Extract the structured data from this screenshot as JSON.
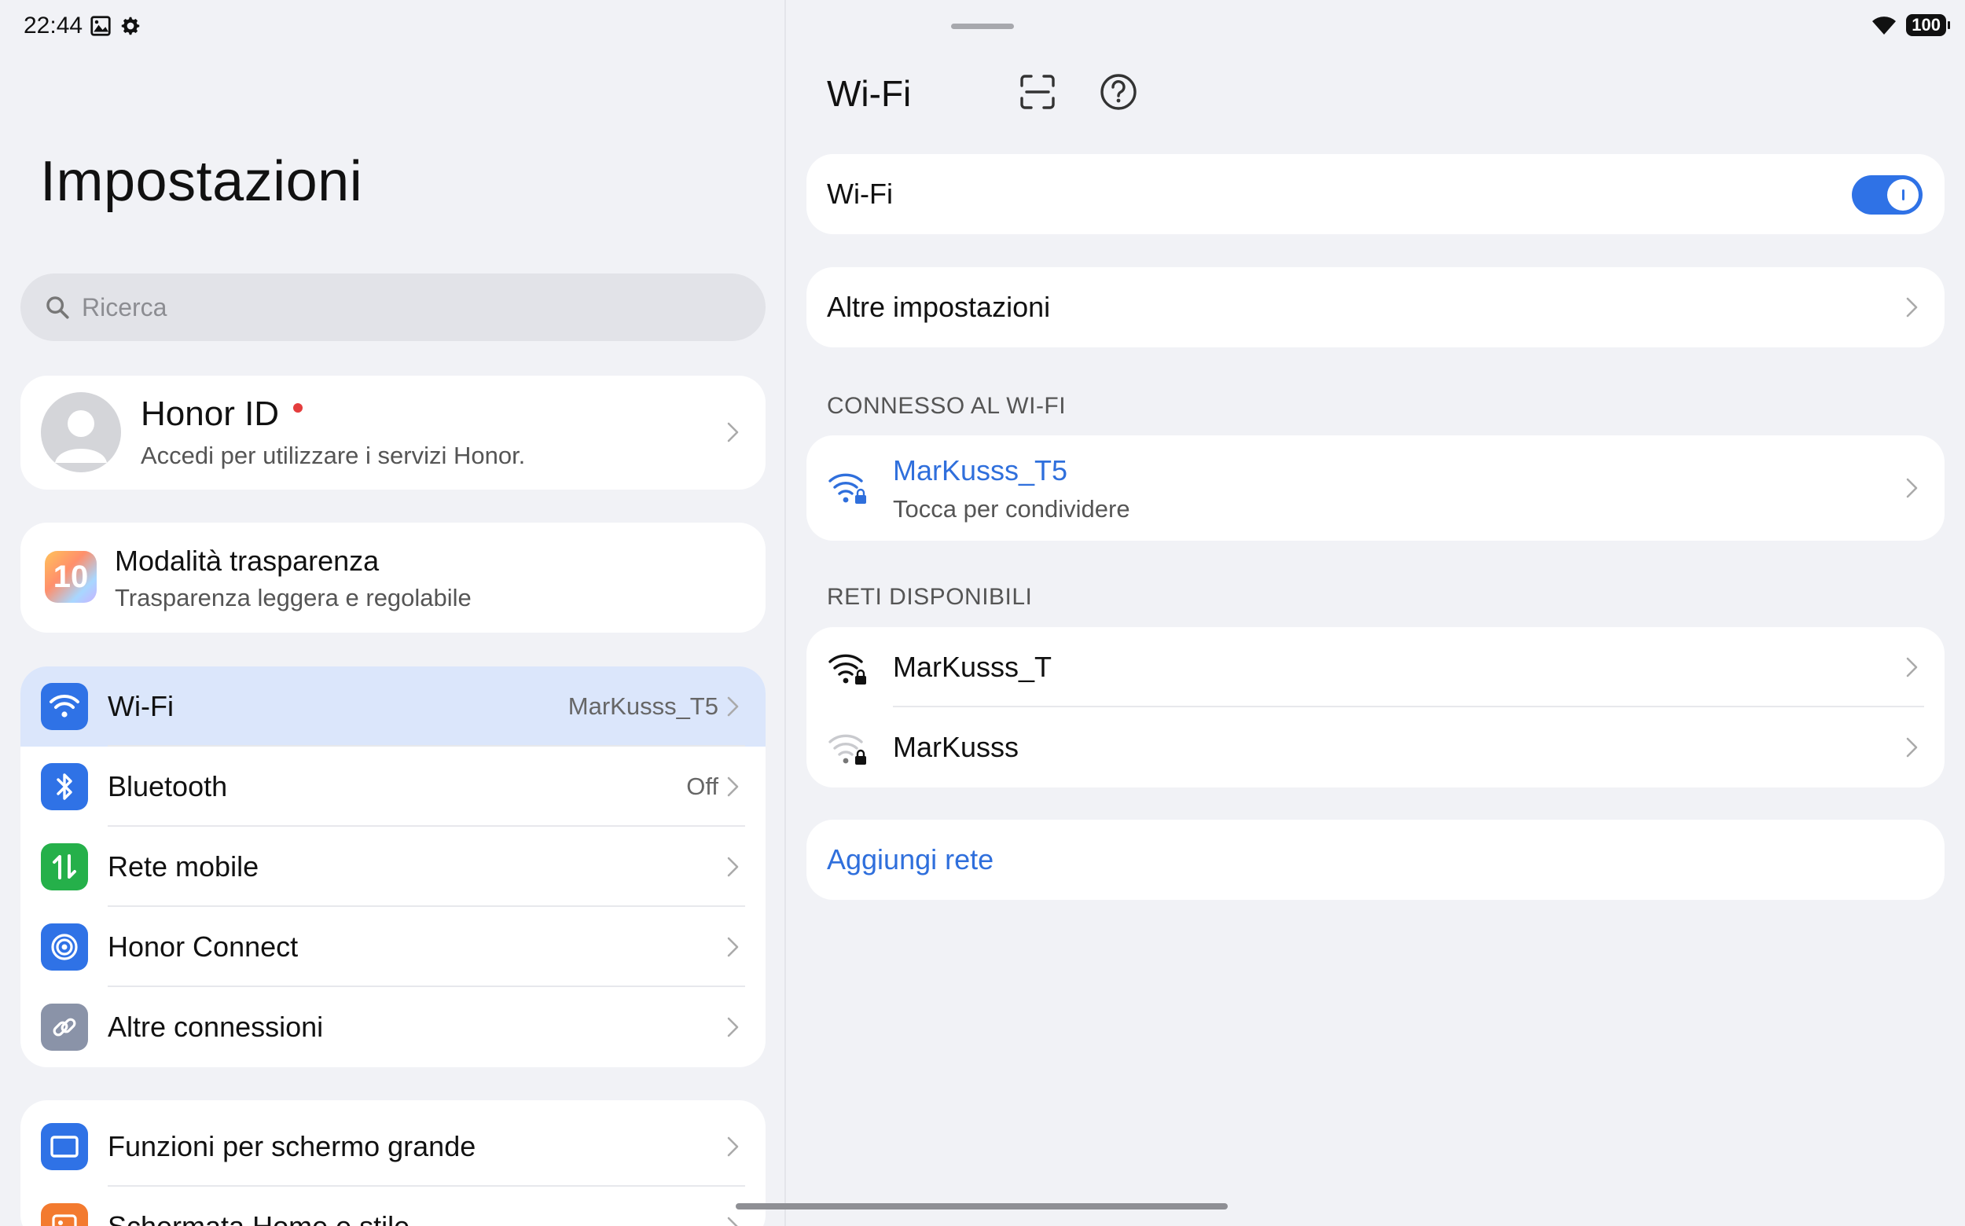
{
  "status_bar": {
    "time": "22:44",
    "battery": "100",
    "icons": [
      "image-icon",
      "gear-icon",
      "wifi-signal-icon",
      "battery-icon"
    ]
  },
  "left": {
    "title": "Impostazioni",
    "search": {
      "placeholder": "Ricerca"
    },
    "honor_id": {
      "title": "Honor ID",
      "subtitle": "Accedi per utilizzare i servizi Honor."
    },
    "transparency": {
      "title": "Modalità trasparenza",
      "subtitle": "Trasparenza leggera e regolabile",
      "icon_text": "10"
    },
    "items": [
      {
        "label": "Wi-Fi",
        "value": "MarKusss_T5",
        "icon": "wifi-icon",
        "color": "#2f72e6",
        "selected": true
      },
      {
        "label": "Bluetooth",
        "value": "Off",
        "icon": "bluetooth-icon",
        "color": "#2f72e6"
      },
      {
        "label": "Rete mobile",
        "value": "",
        "icon": "mobile-data-icon",
        "color": "#25b04a"
      },
      {
        "label": "Honor Connect",
        "value": "",
        "icon": "honor-connect-icon",
        "color": "#2f72e6"
      },
      {
        "label": "Altre connessioni",
        "value": "",
        "icon": "link-icon",
        "color": "#8a93a8"
      }
    ],
    "items2": [
      {
        "label": "Funzioni per schermo grande",
        "icon": "large-screen-icon",
        "color": "#2f72e6"
      },
      {
        "label": "Schermata Home e stile",
        "icon": "home-style-icon",
        "color": "#f37a2f"
      }
    ]
  },
  "right": {
    "title": "Wi-Fi",
    "wifi_toggle": {
      "label": "Wi-Fi",
      "on": true
    },
    "more_settings": "Altre impostazioni",
    "connected_header": "CONNESSO AL WI-FI",
    "connected": {
      "name": "MarKusss_T5",
      "subtitle": "Tocca per condividere"
    },
    "available_header": "RETI DISPONIBILI",
    "networks": [
      {
        "name": "MarKusss_T",
        "signal": "strong"
      },
      {
        "name": "MarKusss",
        "signal": "weak"
      }
    ],
    "add_network": "Aggiungi rete"
  },
  "colors": {
    "accent": "#2f72e6",
    "link": "#2f6fdc",
    "background": "#f1f2f6",
    "selected_row": "#dbe6fb"
  }
}
